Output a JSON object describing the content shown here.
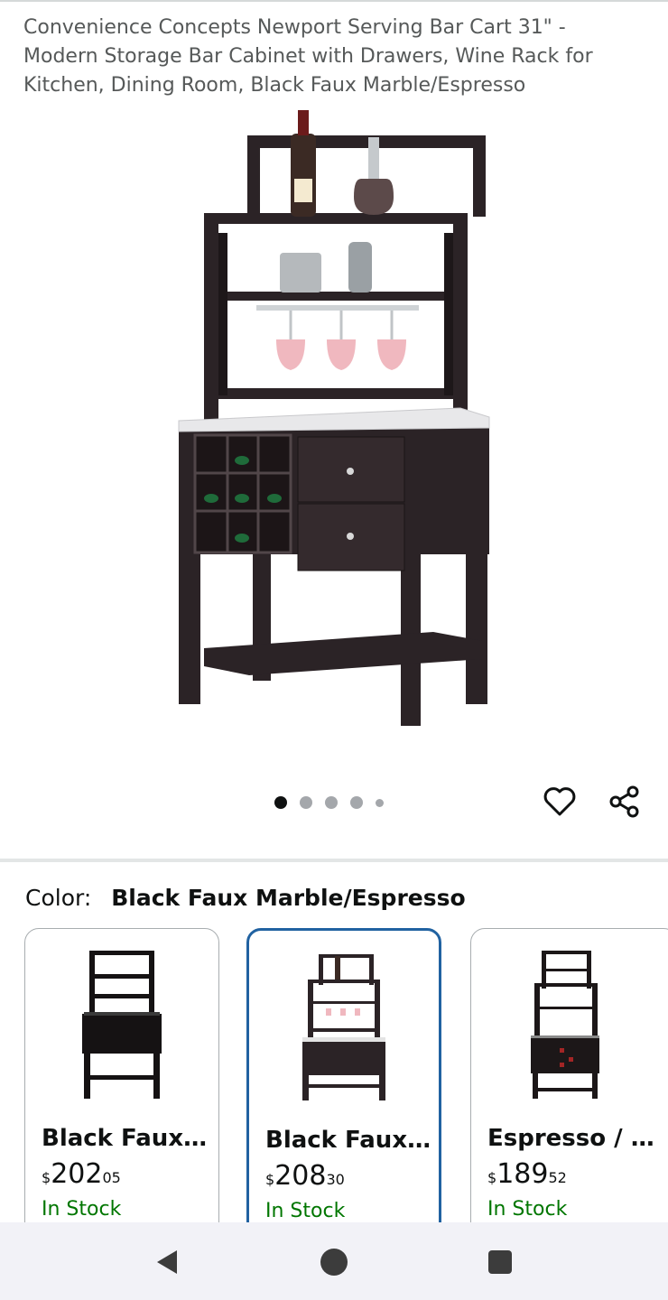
{
  "product": {
    "title": "Convenience Concepts Newport Serving Bar Cart 31\" - Modern Storage Bar Cabinet with Drawers, Wine Rack for Kitchen, Dining Room, Black Faux Marble/Espresso"
  },
  "gallery": {
    "image_count": 5,
    "active_index": 0
  },
  "actions": {
    "wishlist_icon": "heart-outline-icon",
    "share_icon": "share-icon"
  },
  "color": {
    "label": "Color:",
    "selected": "Black Faux Marble/Espresso"
  },
  "variants": [
    {
      "name": "Black Faux...",
      "currency": "$",
      "price_whole": "202",
      "price_cents": "05",
      "stock": "In Stock",
      "selected": false
    },
    {
      "name": "Black Faux...",
      "currency": "$",
      "price_whole": "208",
      "price_cents": "30",
      "stock": "In Stock",
      "selected": true
    },
    {
      "name": "Espresso / ...",
      "currency": "$",
      "price_whole": "189",
      "price_cents": "52",
      "stock": "In Stock",
      "selected": false
    }
  ],
  "system_nav": {
    "back_icon": "back-triangle-icon",
    "home_icon": "home-circle-icon",
    "recents_icon": "recents-square-icon"
  },
  "colors": {
    "selected_border": "#2162a1",
    "in_stock": "#007600",
    "title_gray": "#565959",
    "dark_wood": "#2b2326"
  }
}
